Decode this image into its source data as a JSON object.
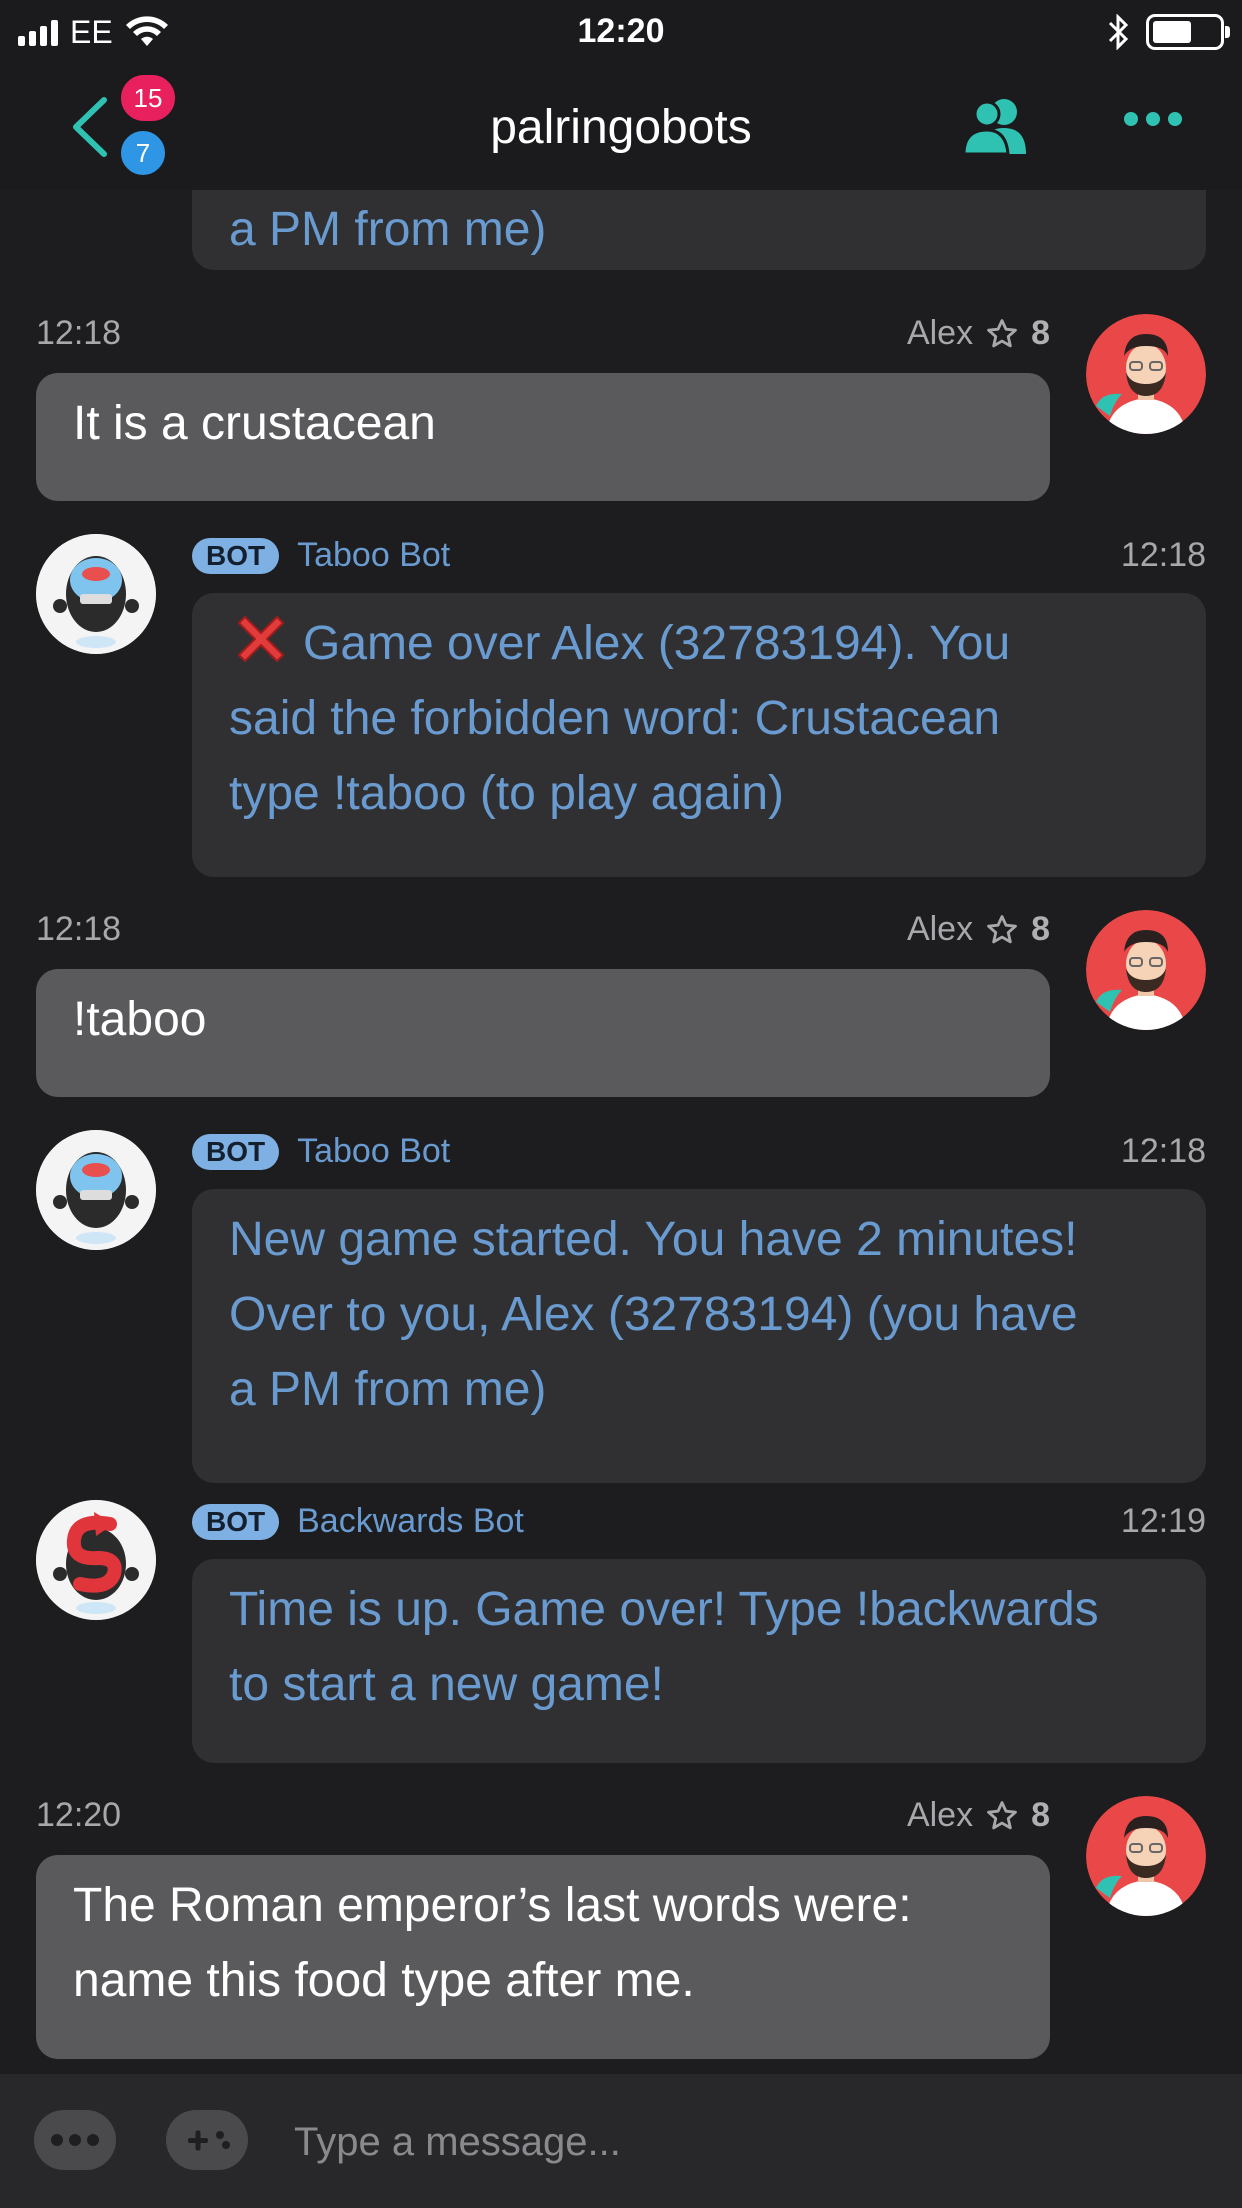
{
  "status_bar": {
    "carrier": "EE",
    "time": "12:20",
    "battery_level": 0.6
  },
  "header": {
    "title": "palringobots",
    "unread_red": "15",
    "unread_blue": "7",
    "accent_color": "#2fc2b3"
  },
  "messages": [
    {
      "type": "bot-partial",
      "text": "a PM from me)"
    },
    {
      "type": "out",
      "time": "12:18",
      "sender": "Alex",
      "reputation": "8",
      "text": "It is a crustacean"
    },
    {
      "type": "bot",
      "tag": "BOT",
      "sender": "Taboo Bot",
      "time": "12:18",
      "icon": "cross-mark-icon",
      "lines": [
        "Game over Alex (32783194). You",
        "said the forbidden word: Crustacean",
        "type !taboo (to play again)"
      ]
    },
    {
      "type": "out",
      "time": "12:18",
      "sender": "Alex",
      "reputation": "8",
      "text": "!taboo"
    },
    {
      "type": "bot",
      "tag": "BOT",
      "sender": "Taboo Bot",
      "time": "12:18",
      "lines": [
        "New game started. You have 2 minutes!",
        "Over to you, Alex (32783194) (you have",
        "a PM from me)"
      ]
    },
    {
      "type": "bot",
      "tag": "BOT",
      "sender": "Backwards Bot",
      "time": "12:19",
      "lines": [
        "Time is up. Game over! Type !backwards",
        "to start a new game!"
      ]
    },
    {
      "type": "out",
      "time": "12:20",
      "sender": "Alex",
      "reputation": "8",
      "lines": [
        "The Roman emperor’s last words were:",
        "name this food type after me."
      ]
    }
  ],
  "composer": {
    "placeholder": "Type a message..."
  }
}
